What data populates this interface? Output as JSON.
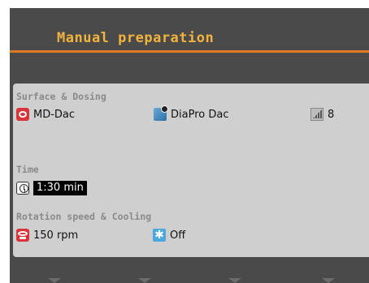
{
  "header": {
    "title": "Manual preparation"
  },
  "sections": {
    "surface": {
      "heading": "Surface & Dosing",
      "surface_value": "MD-Dac",
      "dosing_value": "DiaPro Dac",
      "level_value": "8"
    },
    "time": {
      "heading": "Time",
      "value": "1:30 min"
    },
    "rotation": {
      "heading": "Rotation speed & Cooling",
      "speed_value": "150 rpm",
      "cooling_value": "Off"
    }
  },
  "icons": [
    "disc-icon",
    "dispenser-icon",
    "level-icon",
    "clock-icon",
    "rotation-icon",
    "snowflake-icon"
  ],
  "colors": {
    "title": "#f2b23e",
    "accent_line": "#e07a22",
    "background": "#4a4a4a",
    "panel": "#cfcfcf"
  }
}
